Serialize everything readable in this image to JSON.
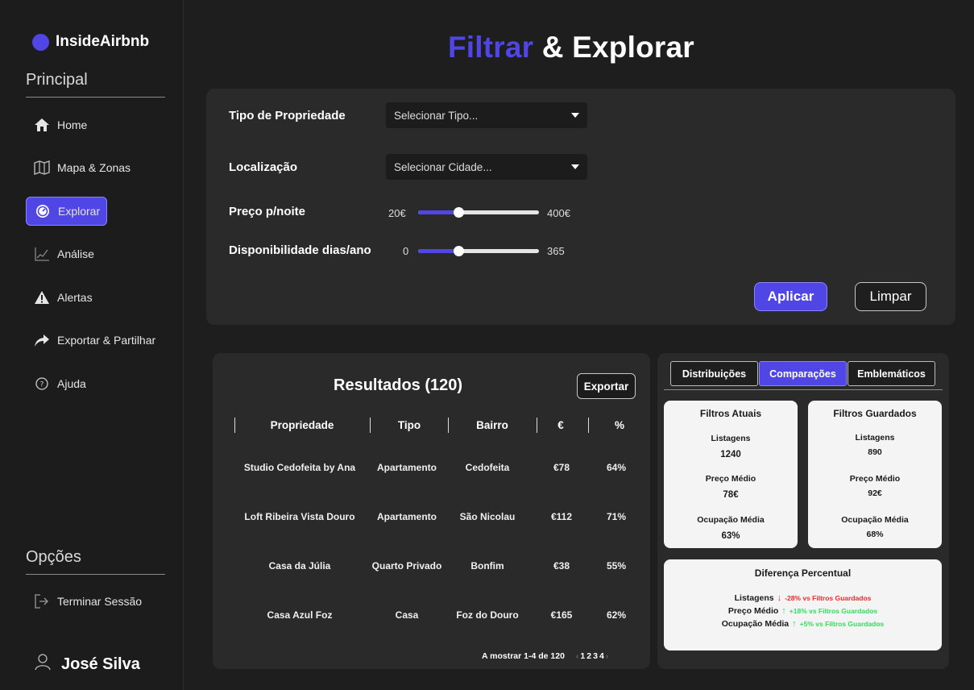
{
  "brand": {
    "name": "InsideAirbnb",
    "accent_color": "#4f46e5"
  },
  "sidebar": {
    "section_principal": "Principal",
    "items": [
      {
        "label": "Home",
        "icon": "home-icon"
      },
      {
        "label": "Mapa & Zonas",
        "icon": "map-icon"
      },
      {
        "label": "Explorar",
        "icon": "compass-icon",
        "active": true
      },
      {
        "label": "Análise",
        "icon": "chart-icon"
      },
      {
        "label": "Alertas",
        "icon": "warning-icon"
      },
      {
        "label": "Exportar & Partilhar",
        "icon": "share-icon"
      },
      {
        "label": "Ajuda",
        "icon": "help-icon"
      }
    ],
    "section_opcoes": "Opções",
    "logout": {
      "label": "Terminar Sessão",
      "icon": "logout-icon"
    },
    "user": {
      "name": "José Silva",
      "icon": "user-icon"
    }
  },
  "header": {
    "title_accent": "Filtrar",
    "title_rest": " & Explorar"
  },
  "filters": {
    "property_type": {
      "label": "Tipo de Propriedade",
      "value": "Selecionar Tipo..."
    },
    "location": {
      "label": "Localização",
      "value": "Selecionar Cidade..."
    },
    "price": {
      "label": "Preço p/noite",
      "min_label": "20€",
      "max_label": "400€",
      "fill_fraction": 0.33
    },
    "availability": {
      "label": "Disponibilidade dias/ano",
      "min_label": "0",
      "max_label": "365",
      "fill_fraction": 0.33
    },
    "apply_label": "Aplicar",
    "clear_label": "Limpar"
  },
  "results": {
    "title": "Resultados (120)",
    "export_label": "Exportar",
    "columns": [
      "Propriedade",
      "Tipo",
      "Bairro",
      "€",
      "%"
    ],
    "rows": [
      [
        "Studio Cedofeita by Ana",
        "Apartamento",
        "Cedofeita",
        "€78",
        "64%"
      ],
      [
        "Loft Ribeira Vista Douro",
        "Apartamento",
        "São Nicolau",
        "€112",
        "71%"
      ],
      [
        "Casa da Júlia",
        "Quarto Privado",
        "Bonfim",
        "€38",
        "55%"
      ],
      [
        "Casa Azul Foz",
        "Casa",
        "Foz do Douro",
        "€165",
        "62%"
      ]
    ],
    "pagination_text": "A mostrar 1-4 de 120",
    "pages": [
      "1",
      "2",
      "3",
      "4"
    ]
  },
  "comparison": {
    "tabs": [
      "Distribuições",
      "Comparações",
      "Emblemáticos"
    ],
    "active_tab": "Comparações",
    "current": {
      "title": "Filtros Atuais",
      "listings_label": "Listagens",
      "listings_value": "1240",
      "price_label": "Preço Médio",
      "price_value": "78€",
      "occupancy_label": "Ocupação Média",
      "occupancy_value": "63%"
    },
    "saved": {
      "title": "Filtros Guardados",
      "listings_label": "Listagens",
      "listings_value": "890",
      "price_label": "Preço Médio",
      "price_value": "92€",
      "occupancy_label": "Ocupação Média",
      "occupancy_value": "68%"
    },
    "diff": {
      "title": "Diferença Percentual",
      "rows": [
        {
          "label": "Listagens",
          "arrow": "↓",
          "text": "-28% vs Filtros Guardados",
          "trend": "negative"
        },
        {
          "label": "Preço Médio",
          "arrow": "↑",
          "text": "+18% vs Filtros Guardados",
          "trend": "positive"
        },
        {
          "label": "Ocupação Média",
          "arrow": "↑",
          "text": "+5% vs Filtros Guardados",
          "trend": "positive"
        }
      ]
    }
  }
}
